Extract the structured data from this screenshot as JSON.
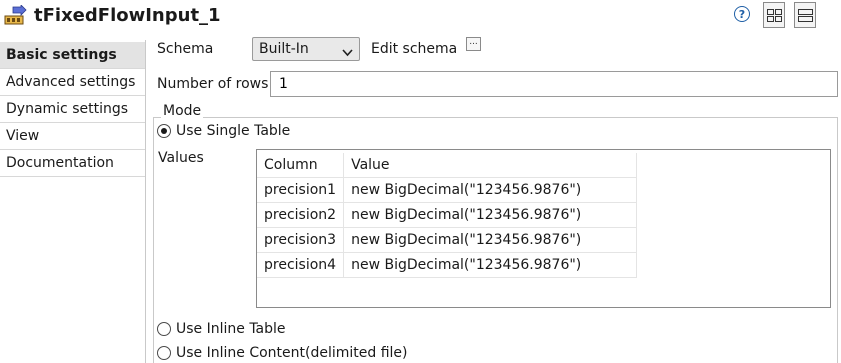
{
  "header": {
    "component_title": "tFixedFlowInput_1",
    "help_icon": "help-icon",
    "help_glyph": "?",
    "view_buttons": [
      "grid-layout-icon",
      "list-layout-icon"
    ]
  },
  "sidebar": {
    "items": [
      {
        "label": "Basic settings",
        "active": true
      },
      {
        "label": "Advanced settings",
        "active": false
      },
      {
        "label": "Dynamic settings",
        "active": false
      },
      {
        "label": "View",
        "active": false
      },
      {
        "label": "Documentation",
        "active": false
      }
    ]
  },
  "form": {
    "schema": {
      "label": "Schema",
      "selected": "Built-In",
      "edit_label": "Edit schema",
      "edit_button_glyph": "..."
    },
    "rows": {
      "label": "Number of rows",
      "value": "1"
    },
    "mode": {
      "legend": "Mode",
      "options": [
        {
          "label": "Use Single Table",
          "selected": true
        },
        {
          "label": "Use Inline Table",
          "selected": false
        },
        {
          "label": "Use Inline Content(delimited file)",
          "selected": false
        }
      ]
    },
    "values": {
      "label": "Values",
      "columns": [
        "Column",
        "Value"
      ],
      "rows": [
        [
          "precision1",
          "new BigDecimal(\"123456.9876\")"
        ],
        [
          "precision2",
          "new BigDecimal(\"123456.9876\")"
        ],
        [
          "precision3",
          "new BigDecimal(\"123456.9876\")"
        ],
        [
          "precision4",
          "new BigDecimal(\"123456.9876\")"
        ]
      ]
    }
  },
  "colors": {
    "active_tab_bg": "#e3e3e3",
    "help_blue": "#1f5fa6",
    "border": "#c9c9c9"
  }
}
